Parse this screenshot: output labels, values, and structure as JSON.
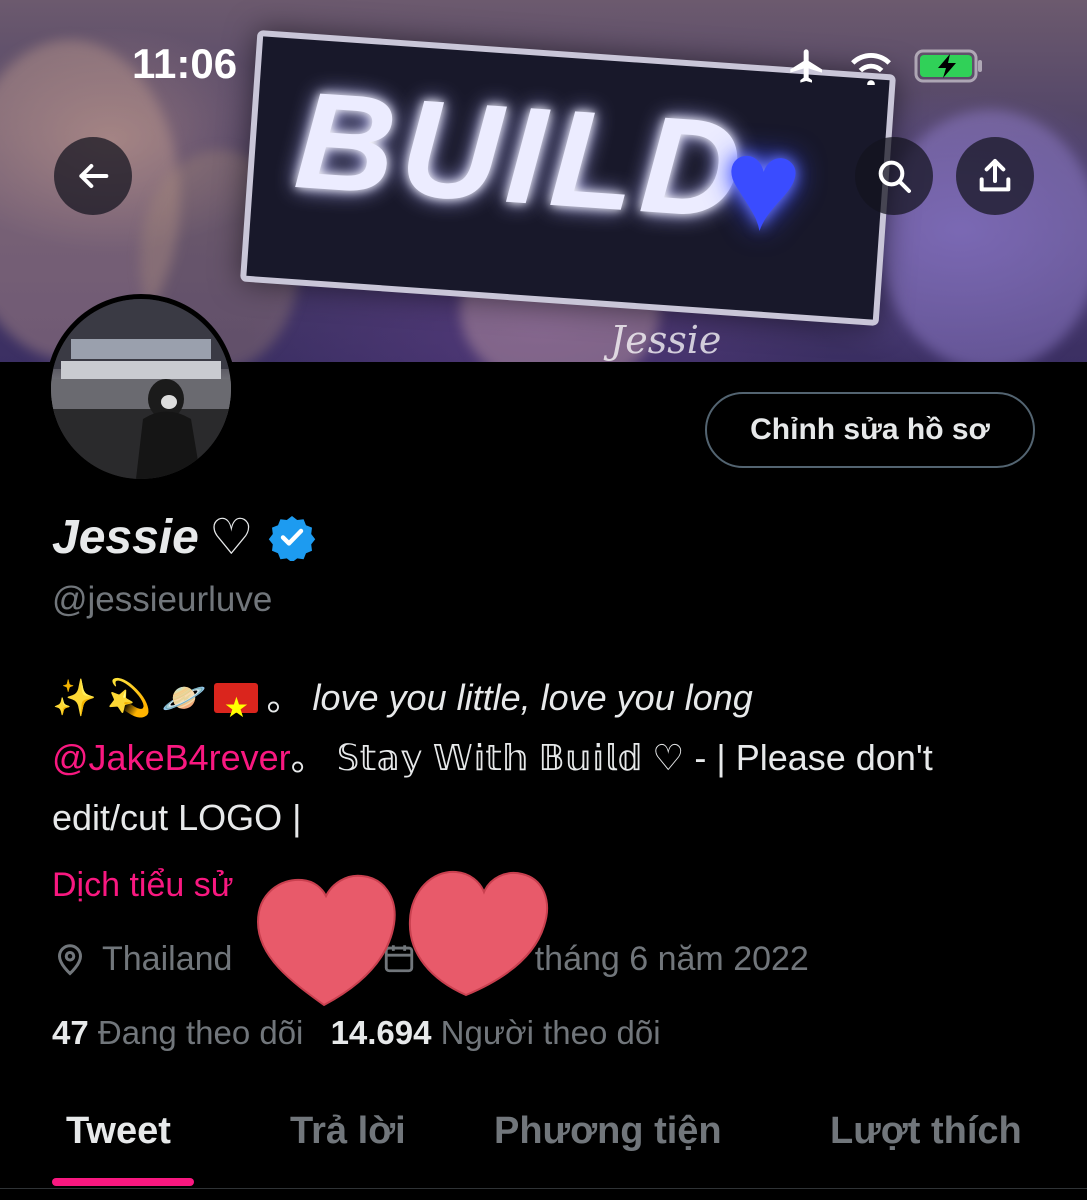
{
  "status_bar": {
    "time": "11:06"
  },
  "banner": {
    "sign_text": "BUILD",
    "signature": "Jessie"
  },
  "header": {
    "back_icon": "arrow-left-icon",
    "search_icon": "search-icon",
    "share_icon": "share-icon"
  },
  "profile": {
    "edit_button": "Chỉnh sửa hồ sơ",
    "display_name": "Jessie",
    "name_heart": "♡",
    "handle": "@jessieurluve",
    "bio": {
      "emojis": "✨ 💫 🪐",
      "separator": "。",
      "tagline": "love you little, love you long",
      "mention": "@JakeB4rever",
      "mention_suffix": "。",
      "stay_text": "𝕊𝕥𝕒𝕪 𝕎𝕚𝕥𝕙 𝔹𝕦𝕚𝕝𝕕 ♡",
      "rest": " - | Please don't edit/cut LOGO |"
    },
    "translate_bio": "Dịch tiểu sử",
    "location": "Thailand",
    "joined_partial": "tha",
    "joined_rest": "tháng 6 năm 2022",
    "following_count": "47",
    "following_label": "Đang theo dõi",
    "followers_count": "14.694",
    "followers_label": "Người theo dõi"
  },
  "tabs": [
    {
      "label": "Tweet",
      "active": true
    },
    {
      "label": "Trả lời",
      "active": false
    },
    {
      "label": "Phương tiện",
      "active": false
    },
    {
      "label": "Lượt thích",
      "active": false
    }
  ],
  "colors": {
    "accent": "#f91880",
    "verified": "#1d9bf0",
    "muted": "#71767b",
    "sticker_heart": "#e85a6a"
  }
}
